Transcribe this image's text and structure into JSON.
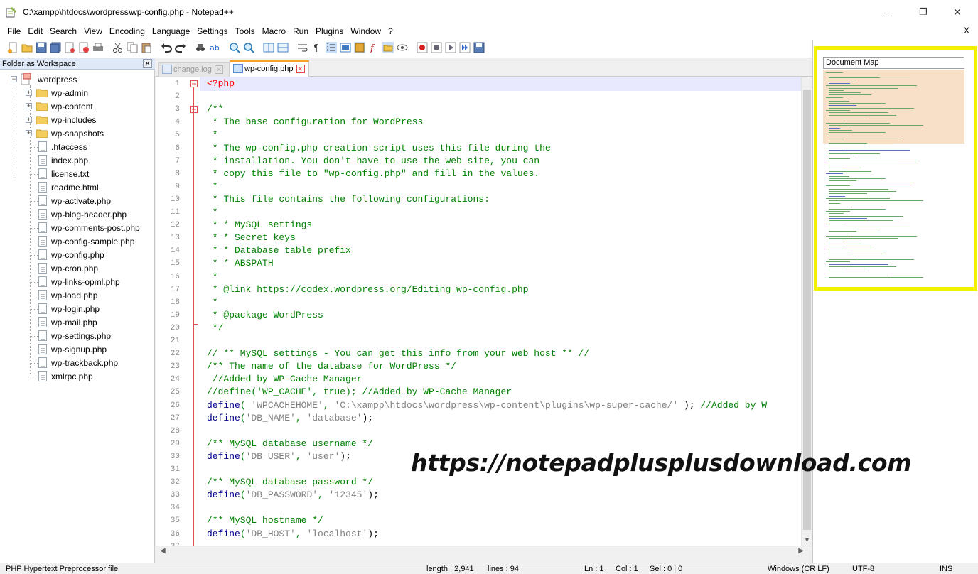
{
  "window": {
    "title": "C:\\xampp\\htdocs\\wordpress\\wp-config.php - Notepad++",
    "minimize": "–",
    "maximize": "❐",
    "close": "✕"
  },
  "menu": {
    "items": [
      "File",
      "Edit",
      "Search",
      "View",
      "Encoding",
      "Language",
      "Settings",
      "Tools",
      "Macro",
      "Run",
      "Plugins",
      "Window",
      "?"
    ],
    "close_label": "X"
  },
  "folder_pane": {
    "title": "Folder as Workspace",
    "close_label": "✕",
    "root": "wordpress",
    "folders": [
      "wp-admin",
      "wp-content",
      "wp-includes",
      "wp-snapshots"
    ],
    "files": [
      ".htaccess",
      "index.php",
      "license.txt",
      "readme.html",
      "wp-activate.php",
      "wp-blog-header.php",
      "wp-comments-post.php",
      "wp-config-sample.php",
      "wp-config.php",
      "wp-cron.php",
      "wp-links-opml.php",
      "wp-load.php",
      "wp-login.php",
      "wp-mail.php",
      "wp-settings.php",
      "wp-signup.php",
      "wp-trackback.php",
      "xmlrpc.php"
    ]
  },
  "tabs": [
    {
      "label": "change.log",
      "active": false
    },
    {
      "label": "wp-config.php",
      "active": true
    }
  ],
  "editor": {
    "line_numbers": [
      "1",
      "2",
      "3",
      "4",
      "5",
      "6",
      "7",
      "8",
      "9",
      "10",
      "11",
      "12",
      "13",
      "14",
      "15",
      "16",
      "17",
      "18",
      "19",
      "20",
      "21",
      "22",
      "23",
      "24",
      "25",
      "26",
      "27",
      "28",
      "29",
      "30",
      "31",
      "32",
      "33",
      "34",
      "35",
      "36",
      "37"
    ],
    "lines": [
      "<?php",
      "",
      "/**",
      " * The base configuration for WordPress",
      " *",
      " * The wp-config.php creation script uses this file during the",
      " * installation. You don't have to use the web site, you can",
      " * copy this file to \"wp-config.php\" and fill in the values.",
      " *",
      " * This file contains the following configurations:",
      " *",
      " * * MySQL settings",
      " * * Secret keys",
      " * * Database table prefix",
      " * * ABSPATH",
      " *",
      " * @link https://codex.wordpress.org/Editing_wp-config.php",
      " *",
      " * @package WordPress",
      " */",
      "",
      "// ** MySQL settings - You can get this info from your web host ** //",
      "/** The name of the database for WordPress */",
      " //Added by WP-Cache Manager",
      "//define('WP_CACHE', true); //Added by WP-Cache Manager",
      "define( 'WPCACHEHOME', 'C:\\xampp\\htdocs\\wordpress\\wp-content\\plugins\\wp-super-cache/' ); //Added by W",
      "define('DB_NAME', 'database');",
      "",
      "/** MySQL database username */",
      "define('DB_USER', 'user');",
      "",
      "/** MySQL database password */",
      "define('DB_PASSWORD', '12345');",
      "",
      "/** MySQL hostname */",
      "define('DB_HOST', 'localhost');",
      ""
    ]
  },
  "document_map": {
    "title": "Document Map"
  },
  "watermark": "https://notepadplusplusdownload.com",
  "status": {
    "language": "PHP Hypertext Preprocessor file",
    "length": "length : 2,941",
    "lines": "lines : 94",
    "ln": "Ln : 1",
    "col": "Col : 1",
    "sel": "Sel : 0 | 0",
    "eol": "Windows (CR LF)",
    "encoding": "UTF-8",
    "mode": "INS"
  },
  "colors": {
    "comment": "#008000",
    "keyword": "#00008b",
    "string": "#808080",
    "php_tag": "#ff0000",
    "docmap_frame": "#f2f200"
  }
}
